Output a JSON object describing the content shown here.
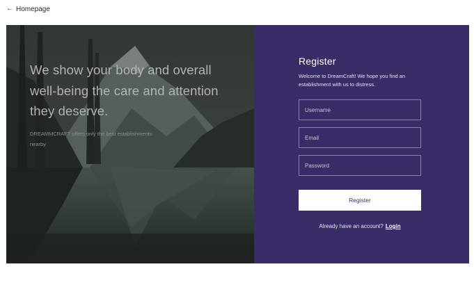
{
  "nav": {
    "back_arrow": "←",
    "back_label": "Homepage"
  },
  "hero": {
    "headline": "We show your body and overall well-being  the care and attention they deserve.",
    "subtext": "DREAMMCRAFT offers only  the best establishments nearby"
  },
  "form": {
    "title": "Register",
    "subtitle": "Welcome to DreamCraft! We hope you find an establishment with us to distress.",
    "fields": [
      {
        "placeholder": "Username",
        "value": ""
      },
      {
        "placeholder": "Email",
        "value": ""
      },
      {
        "placeholder": "Password",
        "value": ""
      }
    ],
    "submit_label": "Register",
    "login_prompt": "Already have an account?",
    "login_link": "Login"
  },
  "colors": {
    "panel_bg": "#3a2c66",
    "field_border": "#8b80b0",
    "button_bg": "#ffffff",
    "button_text": "#3a2c66"
  }
}
